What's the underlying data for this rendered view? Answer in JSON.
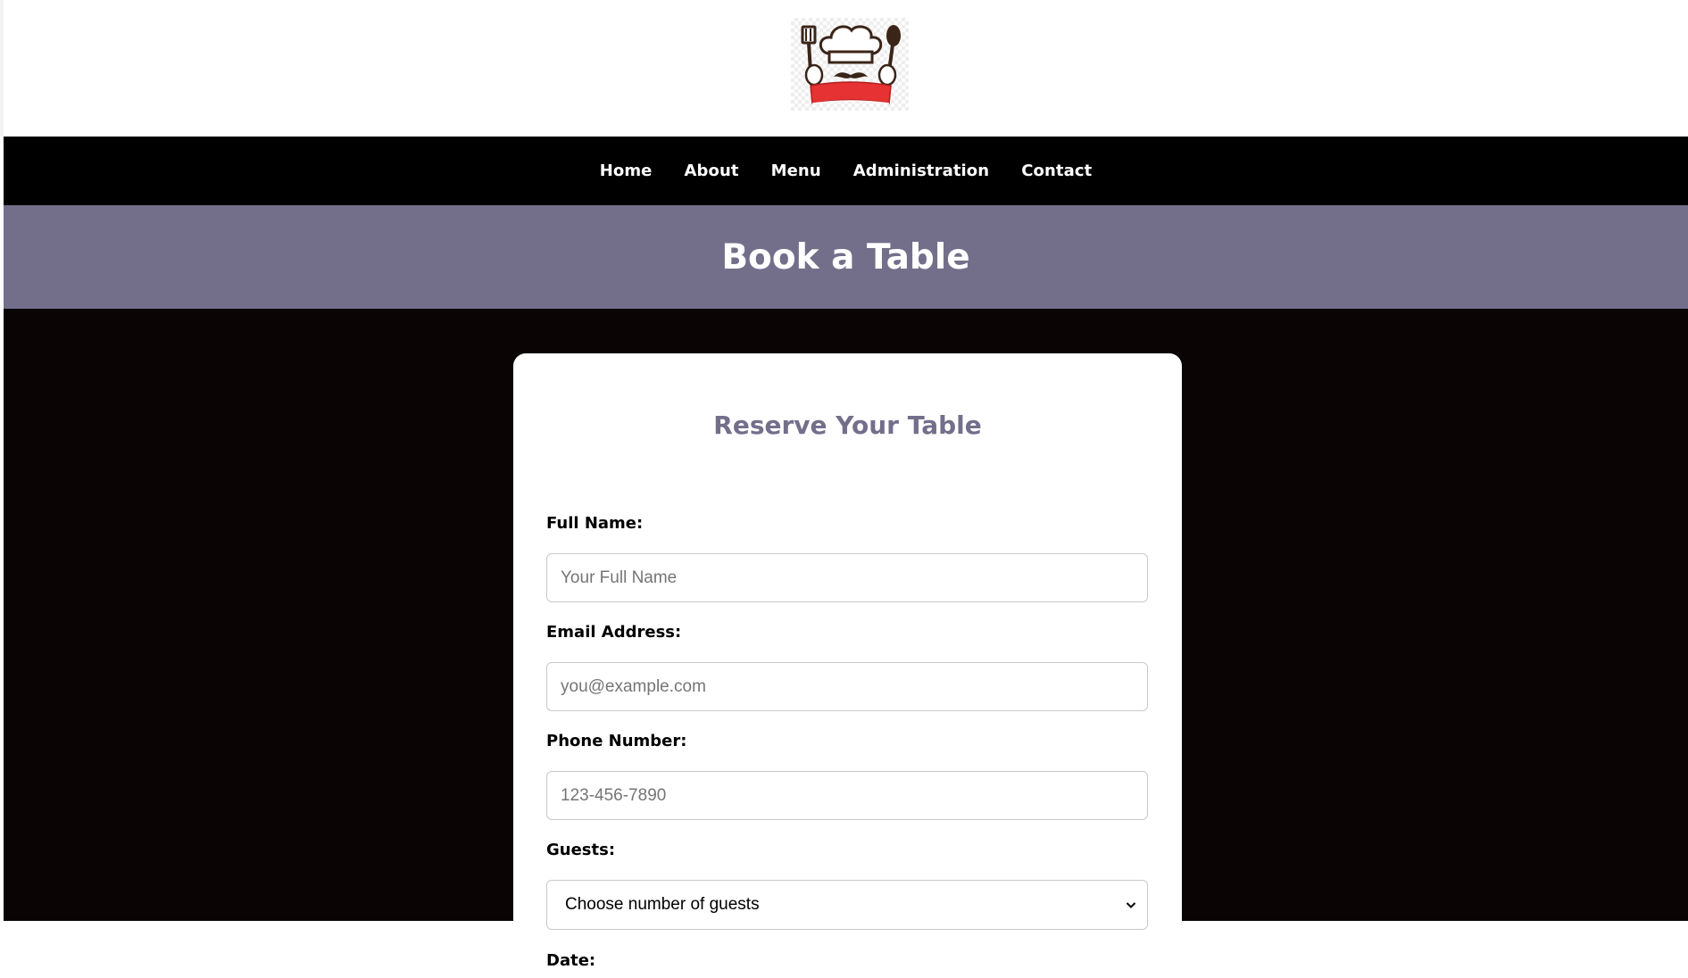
{
  "site": {
    "logo_icon": "chef-logo-icon",
    "accent_color": "#736f8b"
  },
  "nav": {
    "items": [
      {
        "label": "Home"
      },
      {
        "label": "About"
      },
      {
        "label": "Menu"
      },
      {
        "label": "Administration"
      },
      {
        "label": "Contact"
      }
    ]
  },
  "hero": {
    "title": "Book a Table"
  },
  "form": {
    "title": "Reserve Your Table",
    "full_name": {
      "label": "Full Name:",
      "placeholder": "Your Full Name",
      "value": ""
    },
    "email": {
      "label": "Email Address:",
      "placeholder": "you@example.com",
      "value": ""
    },
    "phone": {
      "label": "Phone Number:",
      "placeholder": "123-456-7890",
      "value": ""
    },
    "guests": {
      "label": "Guests:",
      "selected": "Choose number of guests"
    },
    "date": {
      "label": "Date:"
    }
  }
}
